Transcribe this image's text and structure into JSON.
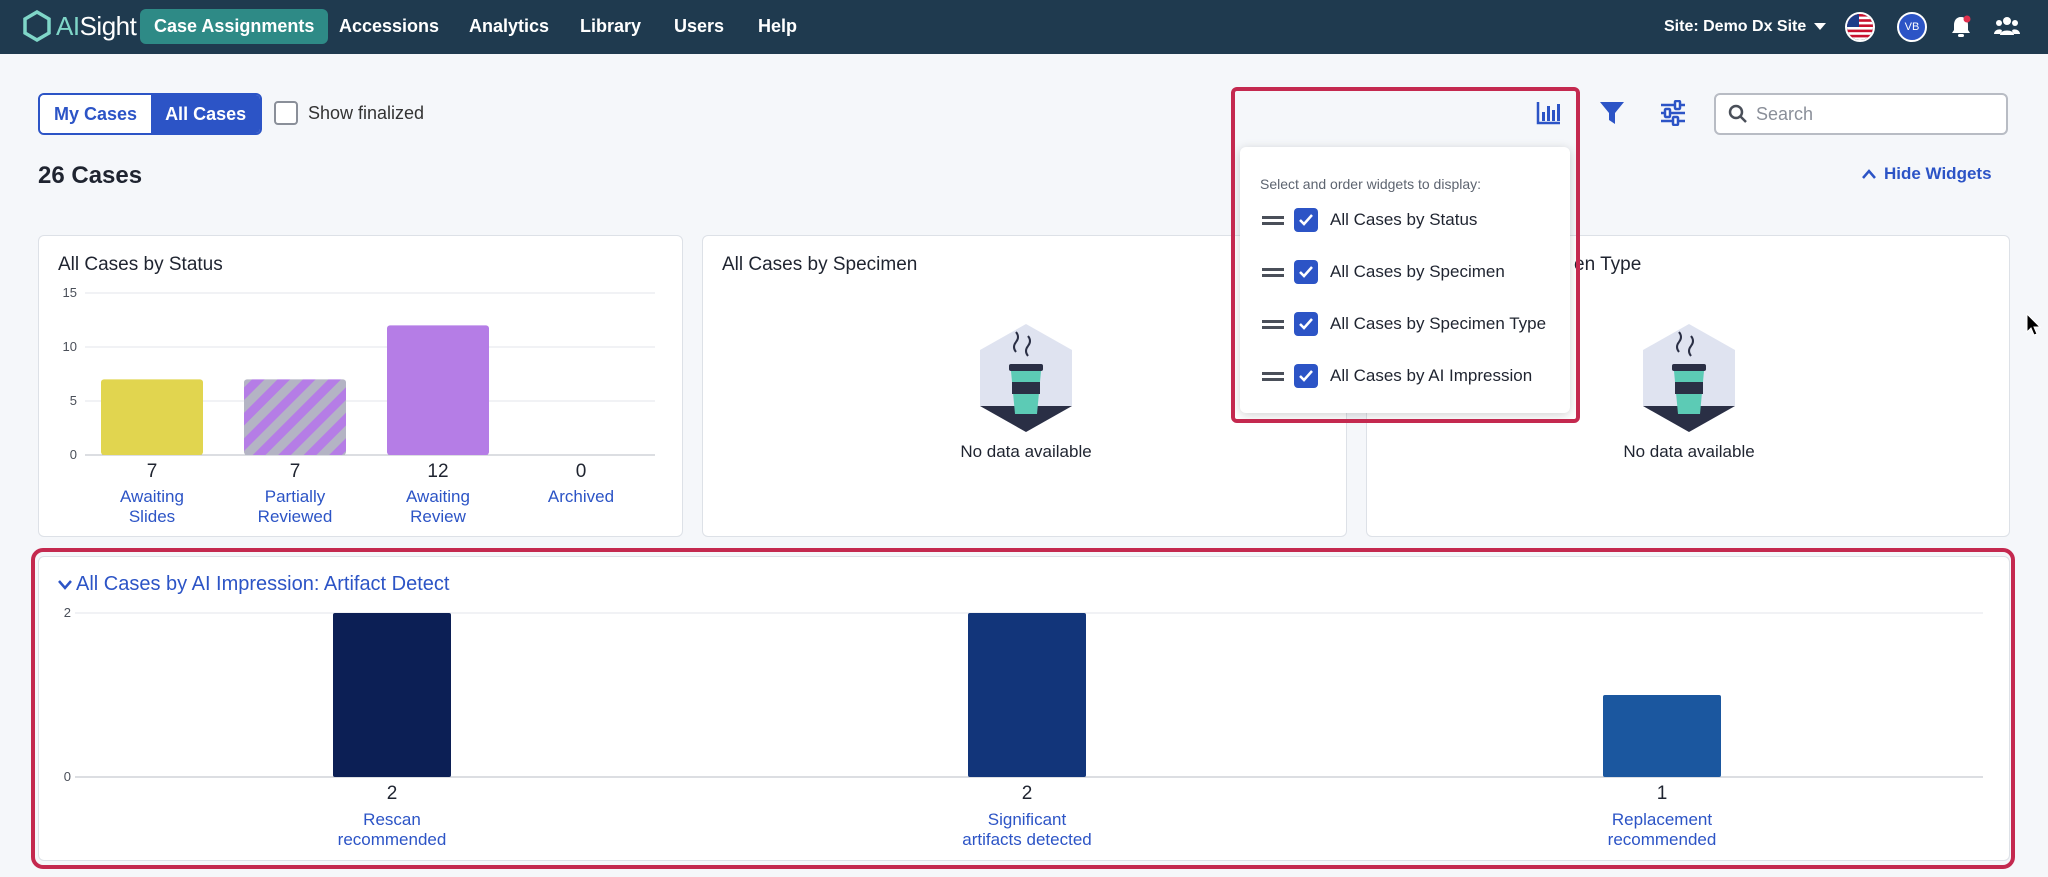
{
  "brand": {
    "name_prefix": "AI",
    "name_suffix": "Sight"
  },
  "nav": {
    "items": [
      "Case Assignments",
      "Accessions",
      "Analytics",
      "Library",
      "Users",
      "Help"
    ],
    "site_label": "Site: Demo Dx Site",
    "avatar_initials": "VB"
  },
  "toolbar": {
    "my_cases": "My Cases",
    "all_cases": "All Cases",
    "show_finalized": "Show finalized",
    "search_placeholder": "Search"
  },
  "summary": {
    "cases_count": "26 Cases",
    "hide_widgets": "Hide Widgets"
  },
  "widgets_popup": {
    "heading": "Select and order widgets to display:",
    "items": [
      {
        "label": "All Cases by Status",
        "checked": true
      },
      {
        "label": "All Cases by Specimen",
        "checked": true
      },
      {
        "label": "All Cases by Specimen Type",
        "checked": true
      },
      {
        "label": "All Cases by AI Impression",
        "checked": true
      }
    ]
  },
  "cards": {
    "status_title": "All Cases by Status",
    "specimen_title": "All Cases by Specimen",
    "specimen_type_title_visible": "en Type",
    "no_data": "No data available",
    "ai_impression_title": "All Cases by AI Impression: Artifact Detect"
  },
  "colors": {
    "nav_bg": "#1f3a4f",
    "accent": "#2c54c6",
    "active_tab": "#2e8a86",
    "highlight": "#c4294f"
  },
  "chart_data": [
    {
      "type": "bar",
      "title": "All Cases by Status",
      "categories": [
        "Awaiting Slides",
        "Partially Reviewed",
        "Awaiting Review",
        "Archived"
      ],
      "category_lines": [
        [
          "Awaiting",
          "Slides"
        ],
        [
          "Partially",
          "Reviewed"
        ],
        [
          "Awaiting",
          "Review"
        ],
        [
          "Archived"
        ]
      ],
      "values": [
        7,
        7,
        12,
        0
      ],
      "value_labels": [
        "7",
        "7",
        "12",
        "0"
      ],
      "colors": [
        "#e1d54f",
        "striped",
        "#b57de6",
        "#cccccc"
      ],
      "yticks": [
        0,
        5,
        10,
        15
      ],
      "ylim": [
        0,
        15
      ],
      "grid": true
    },
    {
      "type": "bar",
      "title": "All Cases by AI Impression: Artifact Detect",
      "categories": [
        "Rescan recommended",
        "Significant artifacts detected",
        "Replacement recommended"
      ],
      "category_lines": [
        [
          "Rescan",
          "recommended"
        ],
        [
          "Significant",
          "artifacts detected"
        ],
        [
          "Replacement",
          "recommended"
        ]
      ],
      "values": [
        2,
        2,
        1
      ],
      "value_labels": [
        "2",
        "2",
        "1"
      ],
      "colors": [
        "#0c1f55",
        "#12357a",
        "#1b579f"
      ],
      "yticks": [
        0,
        2
      ],
      "ylim": [
        0,
        2
      ],
      "grid": true
    }
  ]
}
